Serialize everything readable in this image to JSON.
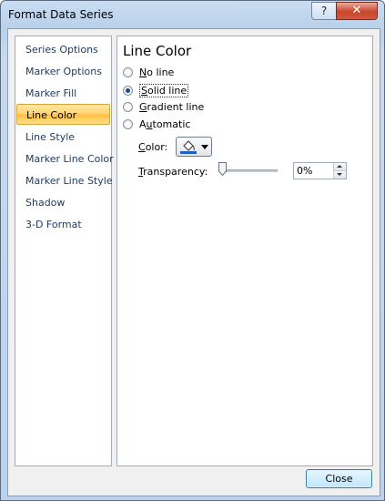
{
  "window": {
    "title": "Format Data Series",
    "help_glyph": "?",
    "close_glyph": "✕"
  },
  "nav": {
    "items": [
      {
        "label": "Series Options"
      },
      {
        "label": "Marker Options"
      },
      {
        "label": "Marker Fill"
      },
      {
        "label": "Line Color",
        "selected": true
      },
      {
        "label": "Line Style"
      },
      {
        "label": "Marker Line Color"
      },
      {
        "label": "Marker Line Style"
      },
      {
        "label": "Shadow"
      },
      {
        "label": "3-D Format"
      }
    ]
  },
  "pane": {
    "title": "Line Color",
    "options": {
      "no_line": {
        "hot": "N",
        "rest": "o line",
        "checked": false
      },
      "solid_line": {
        "hot": "S",
        "rest": "olid line",
        "checked": true
      },
      "gradient_line": {
        "hot": "G",
        "rest": "radient line",
        "checked": false
      },
      "automatic": {
        "pre": "A",
        "hot": "u",
        "rest": "tomatic",
        "checked": false
      }
    },
    "color": {
      "hot": "C",
      "rest": "olor:",
      "swatch": "#1f5fbf",
      "icon": "paint-bucket-icon"
    },
    "transparency": {
      "hot": "T",
      "rest": "ransparency:",
      "value": "0%",
      "level": 0
    }
  },
  "footer": {
    "close_label": "Close"
  },
  "colors": {
    "accent": "#ffd36b",
    "title_bar": "#b9d1ea",
    "close": "#c7462c"
  }
}
